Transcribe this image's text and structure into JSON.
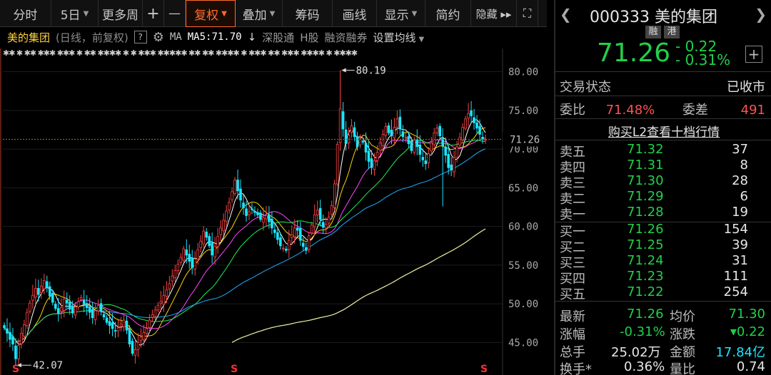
{
  "toolbar": {
    "items": [
      {
        "label": "分时",
        "caret": false
      },
      {
        "label": "5日",
        "caret": true
      },
      {
        "label": "更多周",
        "caret": false
      },
      {
        "label": "+",
        "caret": false
      },
      {
        "label": "—",
        "caret": false
      },
      {
        "label": "复权",
        "caret": true,
        "active": true
      },
      {
        "label": "叠加",
        "caret": true
      },
      {
        "label": "筹码",
        "caret": false
      },
      {
        "label": "画线",
        "caret": false
      },
      {
        "label": "显示",
        "caret": true
      },
      {
        "label": "简约",
        "caret": false
      },
      {
        "label": "隐藏 ▸▸",
        "caret": false
      },
      {
        "label": "⛶",
        "caret": false
      }
    ]
  },
  "info": {
    "stock_name": "美的集团",
    "sub": "(日线，前复权)",
    "help": "?",
    "ma_label": "MA",
    "ma5": "MA5:71.70",
    "ma5_arrow": "↓",
    "links": [
      "深股通",
      "H股",
      "融资融券"
    ],
    "setting": "设置均线"
  },
  "ma_row": "✱✱ ✱ ✱✱ ✱✱✱ ✱✱✱ ✱ ✱✱ ✱✱✱✱ ✱ ✱ ✱✱✱ ✱✱✱✱✱ ✱✱ ✱✱ ✱✱✱✱ ✱ ✱✱✱ ✱✱ ✱✱✱ ✱✱✱✱ ✱ ✱✱✱✱",
  "chart_data": {
    "type": "candlestick",
    "ylim": [
      42,
      83
    ],
    "y_ticks": [
      "80.00",
      "75.00",
      "70.00",
      "65.00",
      "60.00",
      "55.00",
      "50.00",
      "45.00"
    ],
    "high_label": "80.19",
    "low_label": "42.07",
    "current": "71.26",
    "colors": {
      "up": "#ff4444",
      "down": "#1ae6ff",
      "ma5": "#ffffff",
      "ma10": "#ffd400",
      "ma20": "#ff44ff",
      "ma30": "#22ee55",
      "ma60": "#22aaff",
      "ma120": "#f0f0a0"
    },
    "close": [
      46.9,
      46.2,
      45.4,
      44.8,
      42.9,
      44.6,
      46.2,
      47.3,
      48.9,
      50.1,
      51.1,
      52.0,
      51.2,
      52.3,
      53.0,
      52.1,
      51.0,
      50.2,
      49.4,
      48.8,
      49.5,
      50.6,
      50.1,
      49.3,
      48.8,
      49.6,
      50.3,
      50.8,
      50.0,
      49.5,
      48.9,
      48.2,
      49.1,
      49.8,
      49.0,
      48.3,
      47.6,
      47.2,
      46.8,
      46.5,
      46.9,
      47.4,
      47.9,
      46.6,
      44.8,
      43.6,
      44.1,
      45.0,
      45.7,
      46.3,
      46.8,
      47.9,
      48.6,
      49.2,
      49.8,
      50.3,
      51.1,
      51.8,
      52.6,
      53.6,
      54.3,
      55.1,
      56.0,
      57.1,
      56.3,
      55.5,
      54.7,
      55.8,
      57.0,
      58.1,
      59.4,
      58.6,
      57.5,
      56.3,
      57.4,
      58.7,
      59.8,
      60.8,
      62.0,
      63.1,
      64.5,
      66.0,
      64.6,
      63.4,
      62.4,
      61.4,
      61.9,
      62.2,
      61.8,
      61.5,
      60.9,
      61.1,
      61.4,
      60.6,
      59.8,
      59.2,
      58.3,
      57.5,
      57.2,
      56.9,
      58.2,
      58.9,
      59.8,
      59.5,
      58.2,
      57.4,
      56.9,
      58.8,
      60.2,
      61.5,
      62.1,
      60.9,
      59.9,
      60.3,
      61.2,
      62.7,
      65.5,
      70.6,
      75.2,
      72.6,
      70.7,
      71.8,
      73.0,
      71.6,
      70.3,
      71.4,
      70.9,
      69.6,
      68.4,
      67.6,
      68.5,
      69.6,
      70.8,
      71.9,
      72.9,
      72.1,
      71.7,
      72.8,
      73.9,
      72.6,
      71.6,
      71.5,
      70.7,
      69.8,
      71.2,
      70.3,
      69.3,
      68.6,
      68.1,
      69.4,
      70.8,
      72.1,
      72.7,
      71.7,
      70.4,
      69.2,
      67.6,
      67.3,
      68.9,
      70.3,
      71.5,
      72.8,
      73.9,
      74.6,
      74.3,
      73.4,
      72.7,
      71.9,
      71.3,
      71.26
    ],
    "ma_series": [
      "ma5",
      "ma10",
      "ma20",
      "ma30",
      "ma60",
      "ma120"
    ]
  },
  "panel": {
    "code": "000333",
    "name": "美的集团",
    "tags": [
      "融",
      "港"
    ],
    "price": "71.26",
    "change": "- 0.22",
    "change_pct": "- 0.31%",
    "state_label": "交易状态",
    "state_value": "已收市",
    "ratio_label": "委比",
    "ratio_value": "71.48%",
    "diff_label": "委差",
    "diff_value": "491",
    "buy_l2": "购买L2查看十档行情",
    "asks": [
      {
        "name": "卖五",
        "price": "71.32",
        "vol": "37"
      },
      {
        "name": "卖四",
        "price": "71.31",
        "vol": "8"
      },
      {
        "name": "卖三",
        "price": "71.30",
        "vol": "28"
      },
      {
        "name": "卖二",
        "price": "71.29",
        "vol": "6"
      },
      {
        "name": "卖一",
        "price": "71.28",
        "vol": "19"
      }
    ],
    "bids": [
      {
        "name": "买一",
        "price": "71.26",
        "vol": "154"
      },
      {
        "name": "买二",
        "price": "71.25",
        "vol": "39"
      },
      {
        "name": "买三",
        "price": "71.24",
        "vol": "31"
      },
      {
        "name": "买四",
        "price": "71.23",
        "vol": "111"
      },
      {
        "name": "买五",
        "price": "71.22",
        "vol": "254"
      }
    ],
    "stats": {
      "latest_label": "最新",
      "latest": "71.26",
      "avg_label": "均价",
      "avg": "71.30",
      "pct_label": "涨幅",
      "pct": "-0.31%",
      "chg_label": "涨跌",
      "chg": "▾0.22",
      "vol_label": "总手",
      "vol": "25.02万",
      "amt_label": "金额",
      "amt": "17.84亿",
      "turn_label": "换手*",
      "turn": "0.36%",
      "lb_label": "量比",
      "lb": "0.74"
    }
  }
}
